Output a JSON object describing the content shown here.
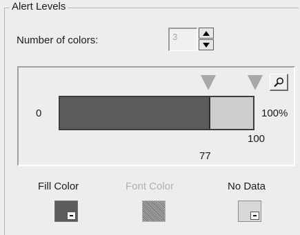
{
  "group": {
    "title": "Alert Levels"
  },
  "number_of_colors": {
    "label": "Number of colors:",
    "value": "3"
  },
  "scale": {
    "min_label": "0",
    "max_label": "100%",
    "threshold_top": "100",
    "threshold_mid": "77",
    "fill_fraction": 0.77
  },
  "colors": {
    "fill_label": "Fill Color",
    "font_label": "Font Color",
    "nodata_label": "No Data",
    "fill_value": "#5c5c5c",
    "nodata_value": "#d8d8d8"
  },
  "icons": {
    "zoom": "magnifier-icon",
    "spin_up": "arrow-up-icon",
    "spin_down": "arrow-down-icon",
    "marker": "threshold-marker-icon"
  }
}
